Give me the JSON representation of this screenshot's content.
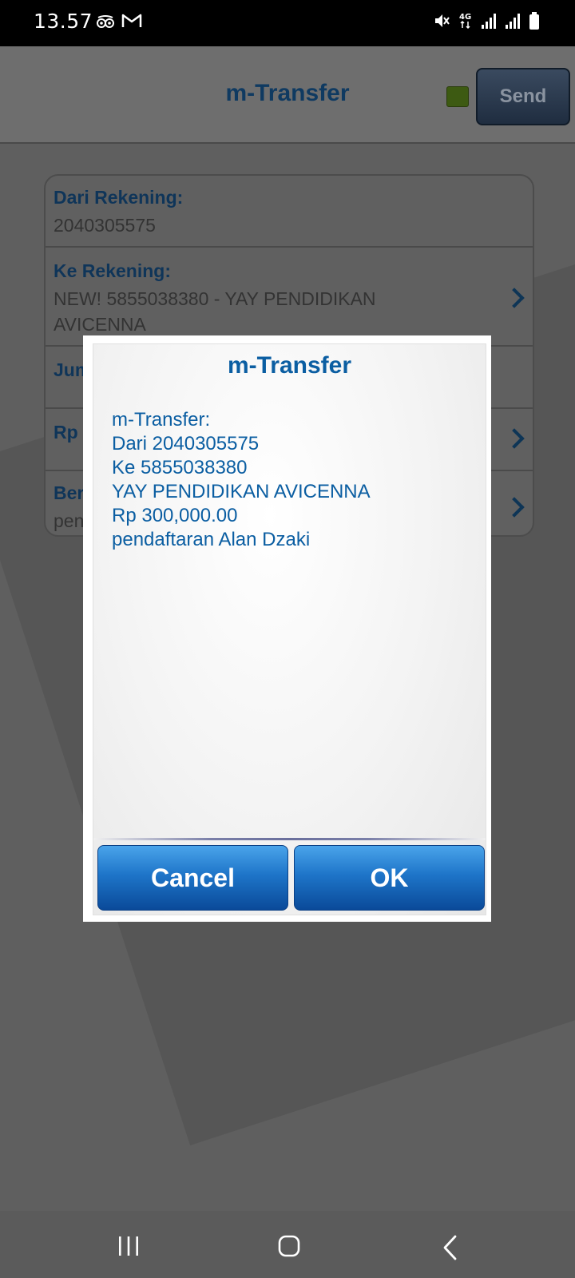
{
  "status_bar": {
    "time": "13.57",
    "icons_left": [
      "tripadvisor-icon",
      "gmail-icon"
    ],
    "icons_right": [
      "mute-icon",
      "4g-icon",
      "signal-icon",
      "signal-icon",
      "battery-icon"
    ]
  },
  "header": {
    "title": "m-Transfer",
    "send_label": "Send",
    "indicator_color": "#3d5a12"
  },
  "form": {
    "rows": [
      {
        "label": "Dari Rekening:",
        "value": "2040305575"
      },
      {
        "label": "Ke Rekening:",
        "value_line1": "NEW! 5855038380 - YAY PENDIDIKAN",
        "value_line2": "AVICENNA"
      },
      {
        "label": "Jum"
      },
      {
        "label": "Rp"
      },
      {
        "label": "Ber",
        "value": "pen"
      }
    ]
  },
  "dialog": {
    "title": "m-Transfer",
    "lines": [
      "m-Transfer:",
      "Dari 2040305575",
      "Ke 5855038380",
      "YAY PENDIDIKAN AVICENNA",
      "Rp 300,000.00",
      "pendaftaran Alan Dzaki"
    ],
    "cancel_label": "Cancel",
    "ok_label": "OK",
    "accent_color": "#0b5ea2"
  },
  "navbar": {
    "icons": [
      "recent-apps-icon",
      "home-icon",
      "back-icon"
    ]
  }
}
